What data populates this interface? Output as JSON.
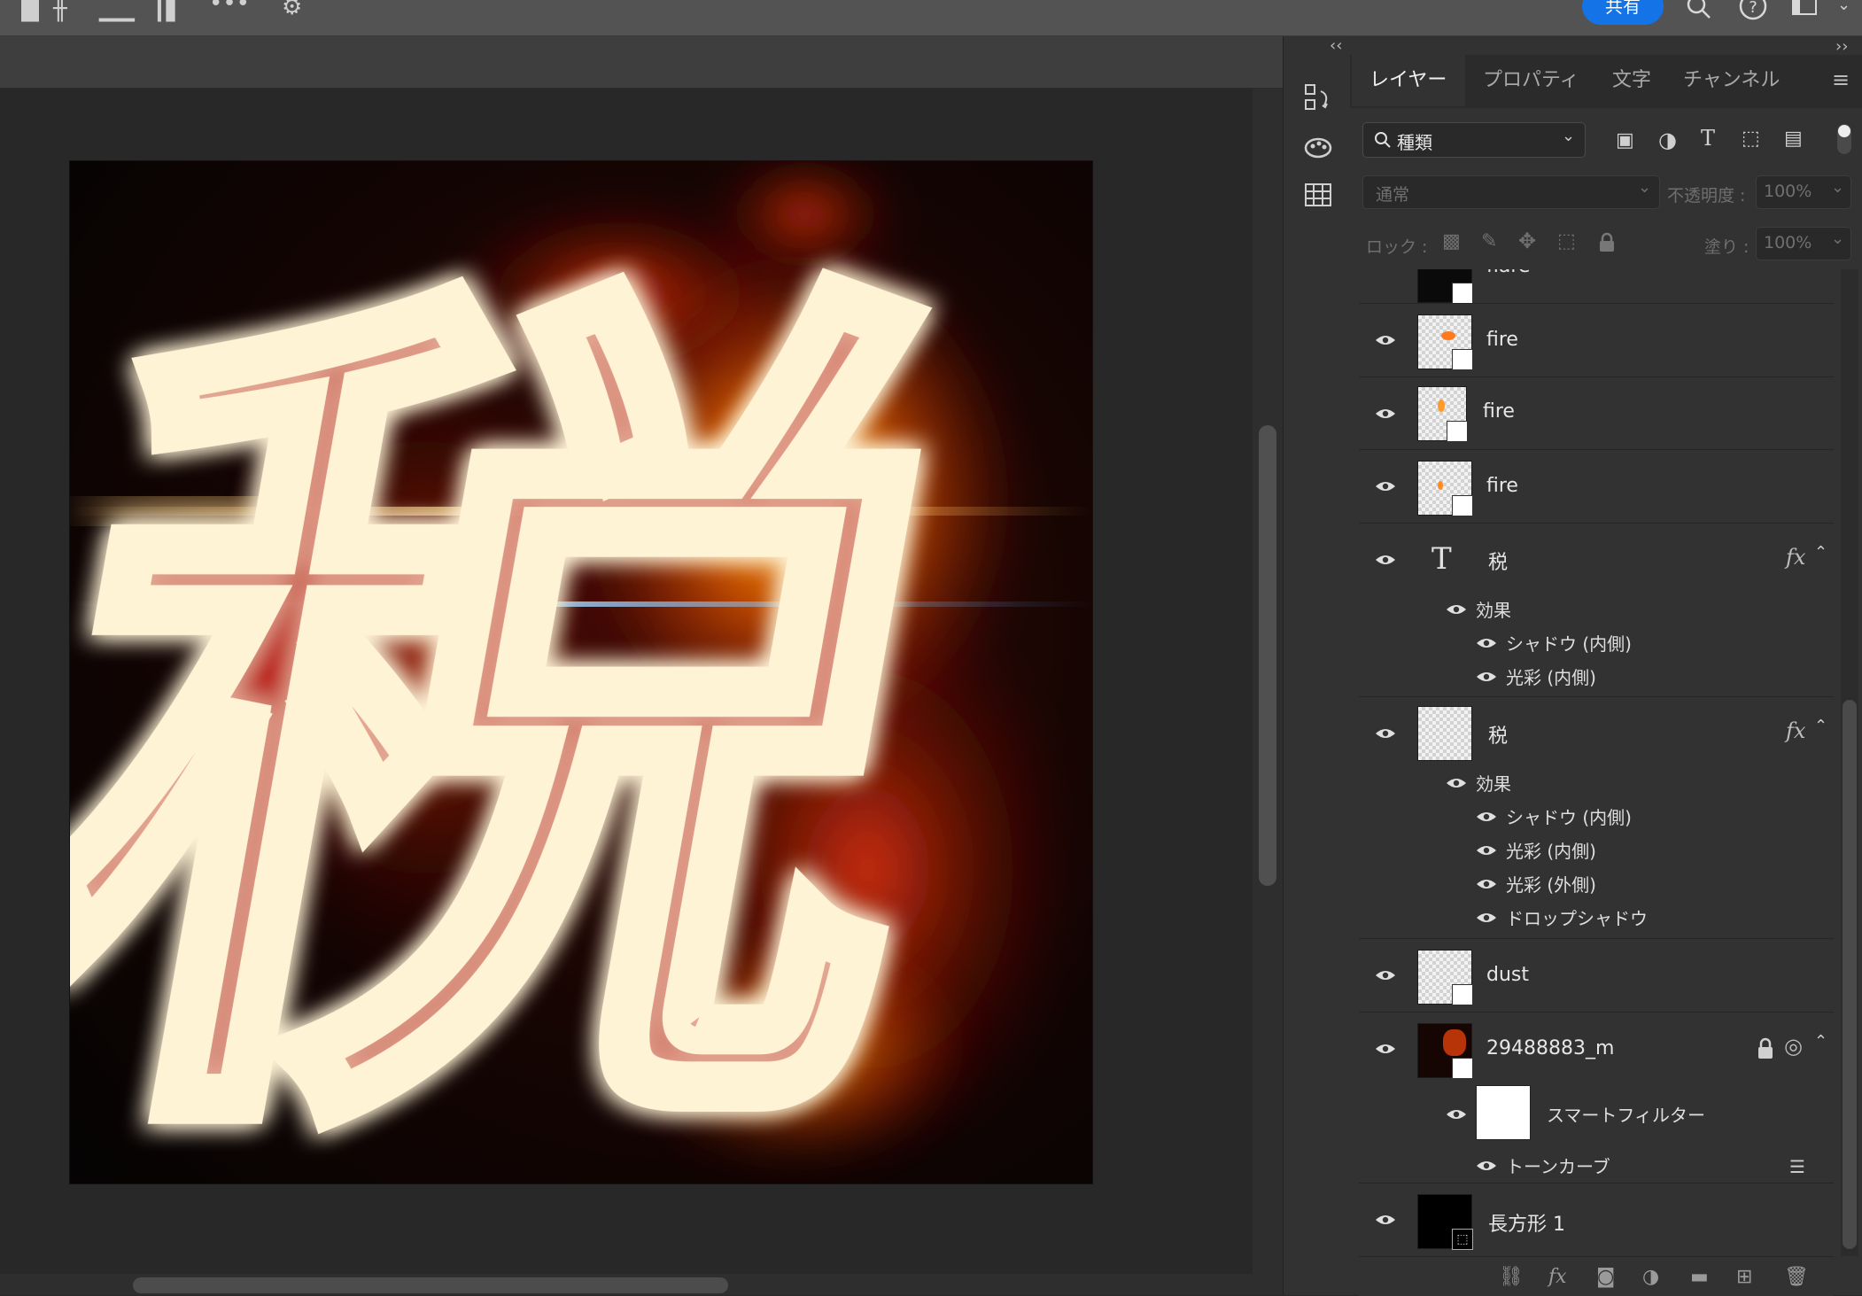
{
  "topbar": {
    "share_label": "共有"
  },
  "tabs": [
    {
      "label": "レイヤー",
      "active": true
    },
    {
      "label": "プロパティ",
      "active": false
    },
    {
      "label": "文字",
      "active": false
    },
    {
      "label": "チャンネル",
      "active": false
    }
  ],
  "filter": {
    "value": "種類"
  },
  "blend": {
    "mode": "通常",
    "opacity_label": "不透明度 :",
    "opacity_value": "100%",
    "lock_label": "ロック :",
    "fill_label": "塗り :",
    "fill_value": "100%"
  },
  "canvas": {
    "glyph": "税"
  },
  "layers": {
    "partial": {
      "name": "flare"
    },
    "fire1": {
      "name": "fire"
    },
    "fire2": {
      "name": "fire"
    },
    "fire3": {
      "name": "fire"
    },
    "text_layer": {
      "name": "税",
      "fx": "fx",
      "effects_label": "効果",
      "effects": [
        "シャドウ (内側)",
        "光彩 (内側)"
      ]
    },
    "raster_layer": {
      "name": "税",
      "fx": "fx",
      "effects_label": "効果",
      "effects": [
        "シャドウ (内側)",
        "光彩 (内側)",
        "光彩 (外側)",
        "ドロップシャドウ"
      ]
    },
    "dust": {
      "name": "dust"
    },
    "photo": {
      "name": "29488883_m",
      "smart_filter": "スマートフィルター",
      "tone_curve": "トーンカーブ"
    },
    "rect": {
      "name": "長方形 1"
    }
  },
  "colors": {
    "accent": "#1473e6",
    "panel": "#323232",
    "canvas_bg": "#282828",
    "fire_red": "#e8160e",
    "fire_orange": "#ff8a00"
  }
}
